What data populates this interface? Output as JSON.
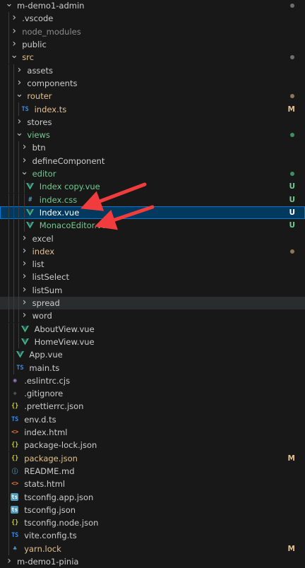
{
  "colors": {
    "folder_default": "#cccccc",
    "folder_untracked": "#73c991",
    "folder_modified": "#e2c08d",
    "ignored": "#8c8c8c",
    "untracked": "#73c991",
    "modified": "#e2c08d",
    "dot_default": "#6e6e6e",
    "dot_untracked": "#3f8f62",
    "dot_modified": "#8c7758",
    "arrow": "#f03c3c"
  },
  "tree": [
    {
      "label": "m-demo1-admin",
      "kind": "folder",
      "open": true,
      "depth": 0,
      "dot": "default"
    },
    {
      "label": ".vscode",
      "kind": "folder",
      "depth": 1
    },
    {
      "label": "node_modules",
      "kind": "folder",
      "depth": 1,
      "status": "ignored"
    },
    {
      "label": "public",
      "kind": "folder",
      "depth": 1
    },
    {
      "label": "src",
      "kind": "folder",
      "open": true,
      "depth": 1,
      "status": "modified",
      "dot": "default"
    },
    {
      "label": "assets",
      "kind": "folder",
      "depth": 2
    },
    {
      "label": "components",
      "kind": "folder",
      "depth": 2
    },
    {
      "label": "router",
      "kind": "folder",
      "open": true,
      "depth": 2,
      "status": "modified",
      "dot": "modified"
    },
    {
      "label": "index.ts",
      "kind": "file",
      "icon": "ts",
      "depth": 3,
      "status": "modified",
      "badge": "M"
    },
    {
      "label": "stores",
      "kind": "folder",
      "depth": 2
    },
    {
      "label": "views",
      "kind": "folder",
      "open": true,
      "depth": 2,
      "status": "untracked",
      "dot": "untracked"
    },
    {
      "label": "btn",
      "kind": "folder",
      "depth": 3
    },
    {
      "label": "defineComponent",
      "kind": "folder",
      "depth": 3
    },
    {
      "label": "editor",
      "kind": "folder",
      "open": true,
      "depth": 3,
      "status": "untracked",
      "dot": "untracked"
    },
    {
      "label": "Index copy.vue",
      "kind": "file",
      "icon": "vue",
      "depth": 4,
      "status": "untracked",
      "badge": "U"
    },
    {
      "label": "index.css",
      "kind": "file",
      "icon": "css",
      "depth": 4,
      "status": "untracked",
      "badge": "U"
    },
    {
      "label": "Index.vue",
      "kind": "file",
      "icon": "vue",
      "depth": 4,
      "status": "untracked",
      "badge": "U",
      "selected": true
    },
    {
      "label": "MonacoEditor.vue",
      "kind": "file",
      "icon": "vue",
      "depth": 4,
      "status": "untracked",
      "badge": "U"
    },
    {
      "label": "excel",
      "kind": "folder",
      "depth": 3
    },
    {
      "label": "index",
      "kind": "folder",
      "depth": 3,
      "status": "modified",
      "dot": "modified"
    },
    {
      "label": "list",
      "kind": "folder",
      "depth": 3
    },
    {
      "label": "listSelect",
      "kind": "folder",
      "depth": 3
    },
    {
      "label": "listSum",
      "kind": "folder",
      "depth": 3
    },
    {
      "label": "spread",
      "kind": "folder",
      "depth": 3,
      "hover": true
    },
    {
      "label": "word",
      "kind": "folder",
      "depth": 3
    },
    {
      "label": "AboutView.vue",
      "kind": "file",
      "icon": "vue",
      "depth": 3
    },
    {
      "label": "HomeView.vue",
      "kind": "file",
      "icon": "vue",
      "depth": 3
    },
    {
      "label": "App.vue",
      "kind": "file",
      "icon": "vue",
      "depth": 2
    },
    {
      "label": "main.ts",
      "kind": "file",
      "icon": "ts",
      "depth": 2
    },
    {
      "label": ".eslintrc.cjs",
      "kind": "file",
      "icon": "eslint",
      "depth": 1
    },
    {
      "label": ".gitignore",
      "kind": "file",
      "icon": "git",
      "depth": 1
    },
    {
      "label": ".prettierrc.json",
      "kind": "file",
      "icon": "json",
      "depth": 1
    },
    {
      "label": "env.d.ts",
      "kind": "file",
      "icon": "ts",
      "depth": 1
    },
    {
      "label": "index.html",
      "kind": "file",
      "icon": "html",
      "depth": 1
    },
    {
      "label": "package-lock.json",
      "kind": "file",
      "icon": "json",
      "depth": 1
    },
    {
      "label": "package.json",
      "kind": "file",
      "icon": "json",
      "depth": 1,
      "status": "modified",
      "badge": "M"
    },
    {
      "label": "README.md",
      "kind": "file",
      "icon": "info",
      "depth": 1
    },
    {
      "label": "stats.html",
      "kind": "file",
      "icon": "html",
      "depth": 1
    },
    {
      "label": "tsconfig.app.json",
      "kind": "file",
      "icon": "tsconfig",
      "depth": 1
    },
    {
      "label": "tsconfig.json",
      "kind": "file",
      "icon": "tsconfig",
      "depth": 1
    },
    {
      "label": "tsconfig.node.json",
      "kind": "file",
      "icon": "json",
      "depth": 1
    },
    {
      "label": "vite.config.ts",
      "kind": "file",
      "icon": "ts",
      "depth": 1
    },
    {
      "label": "yarn.lock",
      "kind": "file",
      "icon": "yarn",
      "depth": 1,
      "status": "modified",
      "badge": "M"
    },
    {
      "label": "m-demo1-pinia",
      "kind": "folder",
      "depth": 0
    }
  ]
}
